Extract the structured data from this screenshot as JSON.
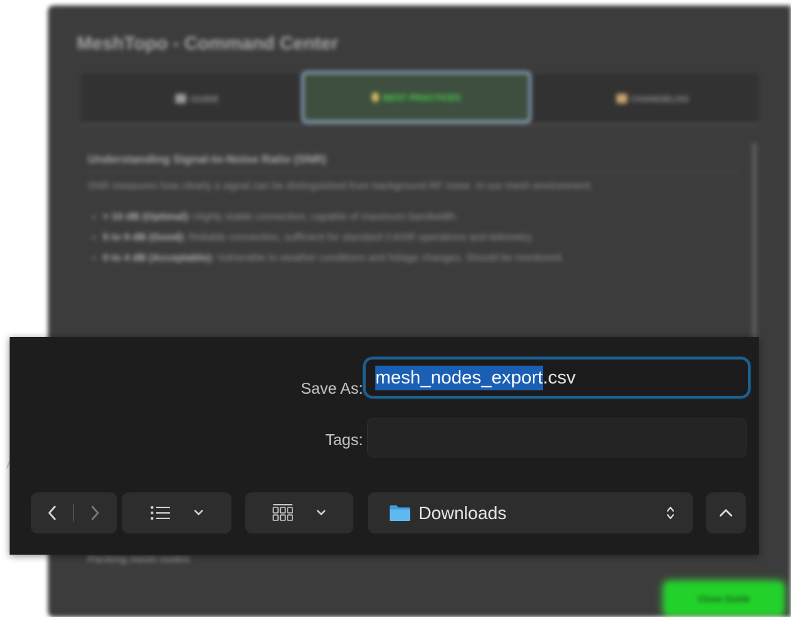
{
  "background_window": {
    "title": "MeshTopo - Command Center",
    "tabs": [
      {
        "label": "GUIDE",
        "icon": "book-icon"
      },
      {
        "label": "BEST PRACTICES",
        "icon": "lightbulb-icon",
        "active": true
      },
      {
        "label": "CHANGELOG",
        "icon": "clipboard-icon"
      }
    ],
    "section_title": "Understanding Signal-to-Noise Ratio (SNR)",
    "paragraph": "SNR measures how clearly a signal can be distinguished from background RF noise. In our mesh environment:",
    "list": [
      {
        "term": "> 10 dB (Optimal):",
        "text": " Highly stable connection, capable of maximum bandwidth."
      },
      {
        "term": "5 to 9 dB (Good):",
        "text": " Reliable connection, sufficient for standard C4ISR operations and telemetry."
      },
      {
        "term": "0 to 4 dB (Acceptable):",
        "text": " Vulnerable to weather conditions and foliage changes. Should be monitored."
      }
    ],
    "footer_text": "Packing mesh nodes",
    "close_button": "Close Guide",
    "colors": {
      "active_tab_text": "#45d14a",
      "close_button_bg": "#22d12a"
    }
  },
  "save_dialog": {
    "save_as_label": "Save As:",
    "filename_selected": "mesh_nodes_export",
    "filename_extension": ".csv",
    "tags_label": "Tags:",
    "tags_value": "",
    "location": "Downloads",
    "icons": {
      "back": "chevron-left-icon",
      "forward": "chevron-right-icon",
      "list_view": "list-icon",
      "grid_view": "grid-icon",
      "dropdown": "chevron-down-icon",
      "folder": "folder-icon",
      "stepper": "up-down-stepper-icon",
      "expand": "chevron-up-icon"
    },
    "colors": {
      "focus_ring": "#1e5f8d",
      "selection": "#1a5fb4",
      "folder": "#5fb8f0"
    }
  }
}
